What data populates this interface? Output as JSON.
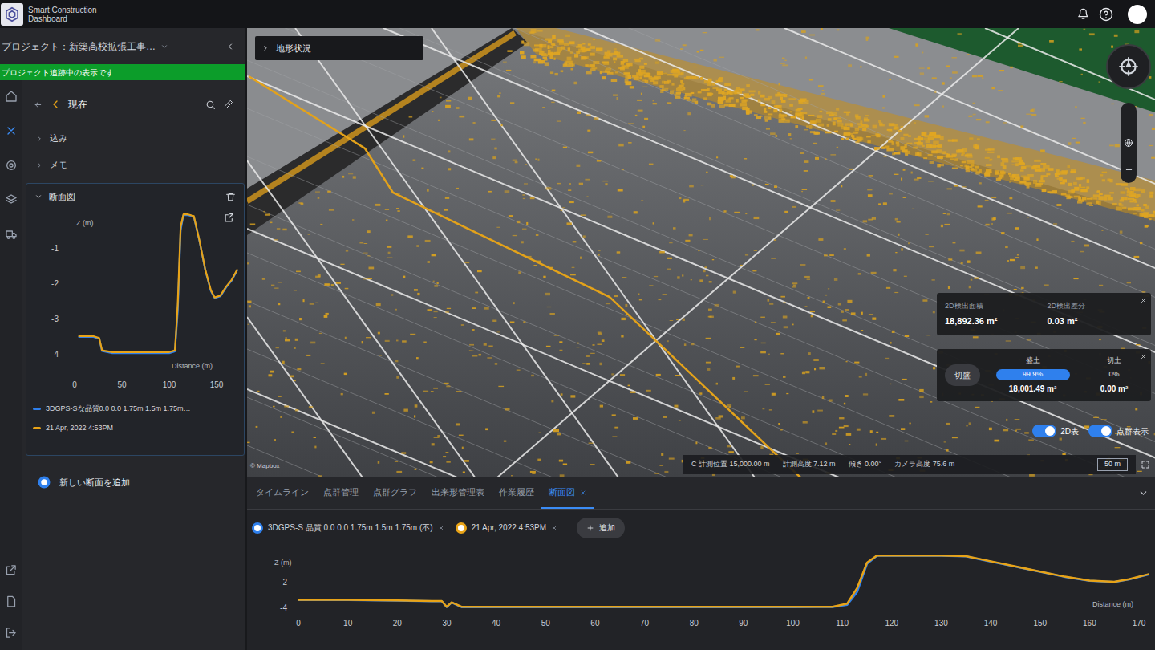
{
  "app": {
    "name_line1": "Smart Construction",
    "name_line2": "Dashboard"
  },
  "icon_rail": {
    "top": [
      {
        "selected": false
      },
      {
        "selected": true
      },
      {
        "selected": false
      },
      {
        "selected": false
      },
      {
        "selected": false
      }
    ],
    "bottom": [
      {
        "selected": false
      },
      {
        "selected": false
      },
      {
        "selected": false
      }
    ]
  },
  "left_panel": {
    "project_label": "プロジェクト：新築高校拡張工事…",
    "status_banner": "プロジェクト追跡中の表示です",
    "back_label": "現在",
    "items": [
      {
        "label": "込み",
        "expanded": false
      },
      {
        "label": "メモ",
        "expanded": false
      }
    ],
    "section": {
      "label": "断面図",
      "expanded": true,
      "chart": {
        "y_label": "Z (m)",
        "x_label": "Distance (m)",
        "y_ticks": [
          "-1",
          "-2",
          "-3",
          "-4"
        ],
        "x_ticks": [
          "0",
          "50",
          "100",
          "150"
        ],
        "x": [
          4,
          10,
          20,
          26,
          29,
          40,
          60,
          80,
          100,
          106,
          109,
          112,
          115,
          120,
          126,
          132,
          138,
          144,
          148,
          154,
          160,
          166,
          172
        ],
        "series": [
          {
            "name": "3DGPS-Sな品質0.0 0.0 1.75m 1.5m 1.75m…",
            "color": "#2f80ed",
            "values": [
              -3.52,
              -3.52,
              -3.52,
              -3.57,
              -3.92,
              -3.98,
              -3.98,
              -3.98,
              -3.98,
              -3.93,
              -2.8,
              -0.5,
              -0.07,
              -0.07,
              -0.12,
              -0.82,
              -1.62,
              -2.22,
              -2.42,
              -2.37,
              -2.12,
              -1.92,
              -1.62
            ]
          },
          {
            "name": "21 Apr, 2022 4:53PM",
            "color": "#e8a317",
            "values": [
              -3.5,
              -3.5,
              -3.5,
              -3.55,
              -3.9,
              -3.95,
              -3.95,
              -3.95,
              -3.95,
              -3.9,
              -2.6,
              -0.4,
              -0.05,
              -0.05,
              -0.1,
              -0.8,
              -1.6,
              -2.2,
              -2.4,
              -2.35,
              -2.1,
              -1.9,
              -1.6
            ]
          }
        ]
      }
    },
    "add_label": "新しい断面を追加"
  },
  "view": {
    "title": "地形状況",
    "attribution": "© Mapbox",
    "area_panel": [
      {
        "label": "2D検出面積",
        "value": "18,892.36 m²"
      },
      {
        "label": "2D検出差分",
        "value": "0.03 m²"
      }
    ],
    "cutfill": {
      "button": "切盛",
      "columns": [
        {
          "label": "盛土",
          "percent": "99.9%",
          "value": "18,001.49 m²",
          "selected": true
        },
        {
          "label": "切土",
          "percent": "0%",
          "value": "0.00 m²",
          "selected": false
        }
      ]
    },
    "toggles": [
      {
        "label": "2D表",
        "on": true
      },
      {
        "label": "点群表示",
        "on": true
      }
    ],
    "status": [
      "C 計測位置 15,000.00 m",
      "計測高度 7.12 m",
      "傾き 0.00°",
      "カメラ高度 75.6 m"
    ],
    "scale": "50 m"
  },
  "bottom": {
    "tabs": [
      {
        "label": "タイムライン",
        "selected": false
      },
      {
        "label": "点群管理",
        "selected": false
      },
      {
        "label": "点群グラフ",
        "selected": false
      },
      {
        "label": "出来形管理表",
        "selected": false
      },
      {
        "label": "作業履歴",
        "selected": false
      },
      {
        "label": "断面図",
        "selected": true
      }
    ],
    "add_button": "追加",
    "chart": {
      "y_label": "Z (m)",
      "x_label": "Distance (m)",
      "y_ticks": [
        "-2",
        "-4"
      ],
      "x_ticks": [
        "0",
        "10",
        "20",
        "30",
        "40",
        "50",
        "60",
        "70",
        "80",
        "90",
        "100",
        "110",
        "120",
        "130",
        "140",
        "150",
        "160",
        "170"
      ],
      "x": [
        0,
        10,
        20,
        27,
        29,
        30,
        31,
        33,
        40,
        60,
        80,
        100,
        108,
        111,
        113,
        115,
        117,
        120,
        130,
        135,
        140,
        145,
        150,
        155,
        160,
        165,
        168,
        172
      ],
      "series": [
        {
          "name": "3DGPS-S 品質 0.0 0.0 1.75m 1.5m 1.75m (不)",
          "color": "#2f80ed",
          "values": [
            -3.42,
            -3.42,
            -3.47,
            -3.52,
            -3.52,
            -3.97,
            -3.62,
            -3.98,
            -3.98,
            -3.98,
            -3.98,
            -3.98,
            -3.97,
            -3.8,
            -2.8,
            -0.6,
            0.03,
            0.03,
            0.03,
            -0.02,
            -0.42,
            -0.82,
            -1.22,
            -1.62,
            -1.92,
            -2.02,
            -1.82,
            -1.42
          ]
        },
        {
          "name": "21 Apr, 2022 4:53PM",
          "color": "#e8a317",
          "values": [
            -3.4,
            -3.4,
            -3.45,
            -3.5,
            -3.5,
            -3.95,
            -3.6,
            -3.95,
            -3.95,
            -3.95,
            -3.95,
            -3.95,
            -3.95,
            -3.7,
            -2.5,
            -0.5,
            0.05,
            0.05,
            0.05,
            0.0,
            -0.4,
            -0.8,
            -1.2,
            -1.6,
            -1.9,
            -2.0,
            -1.8,
            -1.4
          ]
        }
      ]
    }
  }
}
